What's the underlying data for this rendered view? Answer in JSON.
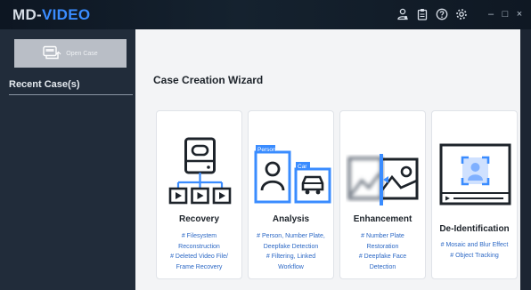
{
  "app": {
    "logo_prefix": "MD-",
    "logo_accent": "VIDEO",
    "window_controls": {
      "minimize": "–",
      "maximize": "□",
      "close": "×"
    },
    "toolbar_icons": [
      "user-settings-icon",
      "clipboard-icon",
      "help-icon",
      "gear-icon"
    ]
  },
  "sidebar": {
    "open_case_label": "Open Case",
    "recent_title": "Recent Case(s)"
  },
  "main": {
    "wizard_title": "Case Creation Wizard",
    "cards": [
      {
        "title": "Recovery",
        "desc": [
          "# Filesystem",
          "Reconstruction",
          "# Deleted Video File/",
          "Frame Recovery"
        ]
      },
      {
        "title": "Analysis",
        "desc": [
          "# Person, Number Plate,",
          "Deepfake Detection",
          "# Filtering, Linked",
          "Workflow"
        ],
        "tag_person": "Person",
        "tag_car": "Car"
      },
      {
        "title": "Enhancement",
        "desc": [
          "# Number Plate",
          "Restoration",
          "# Deepfake Face",
          "Detection"
        ]
      },
      {
        "title": "De-Identification",
        "desc": [
          "# Mosaic and Blur Effect",
          "# Object Tracking"
        ]
      }
    ]
  },
  "colors": {
    "accent": "#3a8cff",
    "link": "#2c68c5",
    "titlebar": "#111c28",
    "sidebar": "#212c3a",
    "main_bg": "#f3f4f6"
  }
}
